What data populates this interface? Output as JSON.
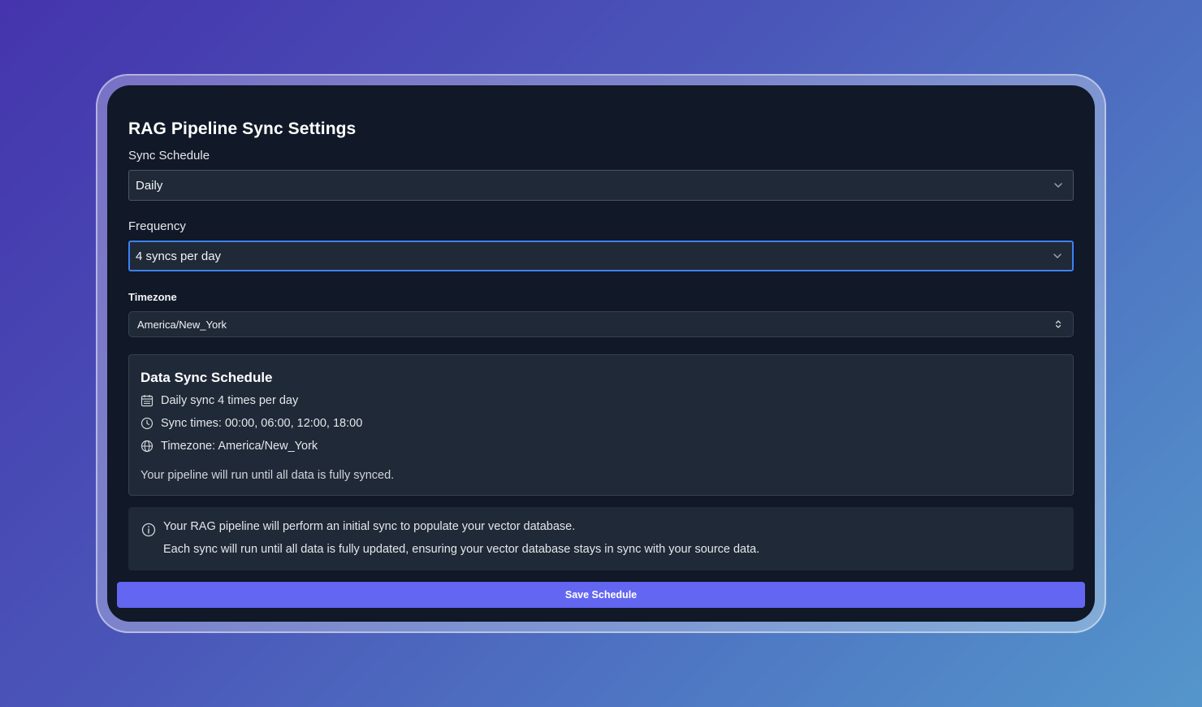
{
  "title": "RAG Pipeline Sync Settings",
  "sync_schedule": {
    "label": "Sync Schedule",
    "value": "Daily",
    "icon": "chevron-down-icon"
  },
  "frequency": {
    "label": "Frequency",
    "value": "4 syncs per day",
    "icon": "chevron-down-icon"
  },
  "timezone": {
    "label": "Timezone",
    "value": "America/New_York",
    "icon": "chevron-up-down-icon"
  },
  "summary": {
    "title": "Data Sync Schedule",
    "items": [
      {
        "icon": "calendar-icon",
        "text": "Daily sync 4 times per day"
      },
      {
        "icon": "clock-icon",
        "text": "Sync times: 00:00, 06:00, 12:00, 18:00"
      },
      {
        "icon": "globe-icon",
        "text": "Timezone: America/New_York"
      }
    ],
    "footer": "Your pipeline will run until all data is fully synced."
  },
  "info": {
    "icon": "info-icon",
    "line1": "Your RAG pipeline will perform an initial sync to populate your vector database.",
    "line2": "Each sync will run until all data is fully updated, ensuring your vector database stays in sync with your source data."
  },
  "save_button": "Save Schedule",
  "colors": {
    "panel_bg": "#111827",
    "field_bg": "#1f2937",
    "focus_border": "#3b82f6",
    "primary": "#6366f1"
  }
}
